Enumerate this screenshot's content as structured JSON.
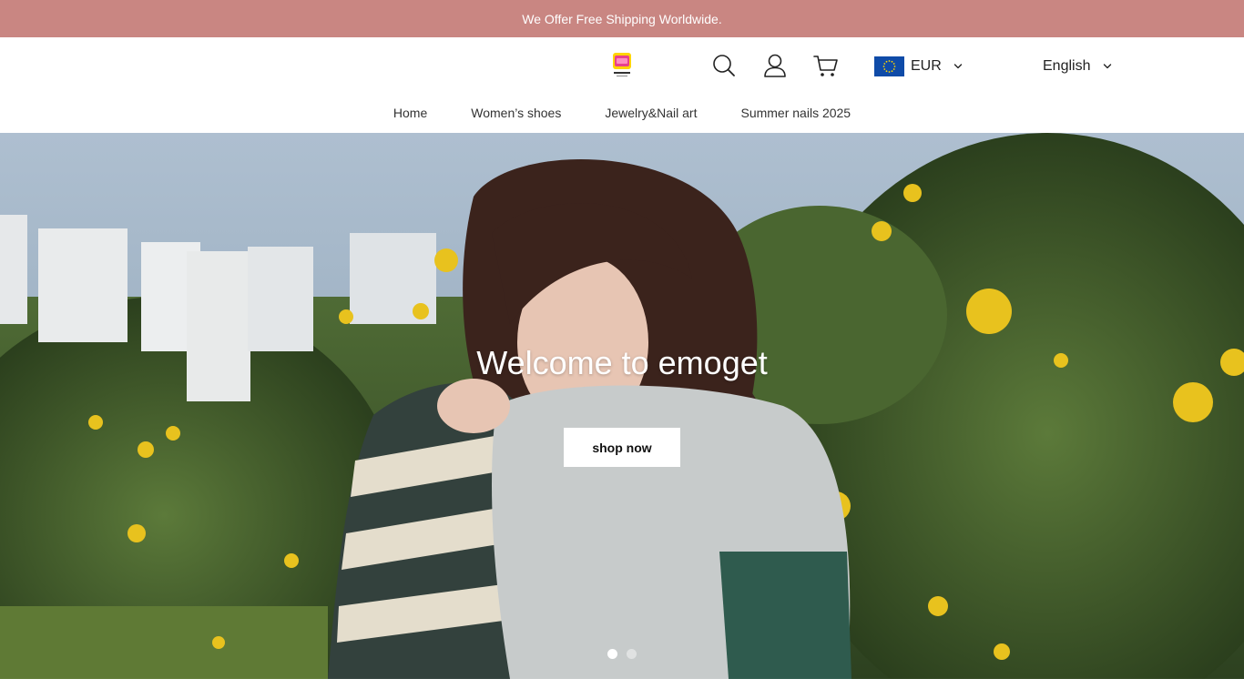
{
  "announcement": {
    "text": "We Offer Free Shipping Worldwide."
  },
  "header": {
    "logo_icon": "emoget-logo-icon",
    "search_icon": "search-icon",
    "account_icon": "user-icon",
    "cart_icon": "cart-icon",
    "currency": {
      "flag_icon": "eu-flag-icon",
      "label": "EUR"
    },
    "language": {
      "label": "English"
    }
  },
  "nav": {
    "items": [
      {
        "label": "Home"
      },
      {
        "label": "Women’s shoes"
      },
      {
        "label": "Jewelry&Nail art"
      },
      {
        "label": "Summer nails 2025"
      }
    ]
  },
  "hero": {
    "title": "Welcome to emoget",
    "button_label": "shop now",
    "slides": 2,
    "active_slide": 1
  },
  "colors": {
    "announcement_bg": "#c98682",
    "eu_flag_blue": "#0f4ba8",
    "eu_flag_star": "#ffd500"
  }
}
